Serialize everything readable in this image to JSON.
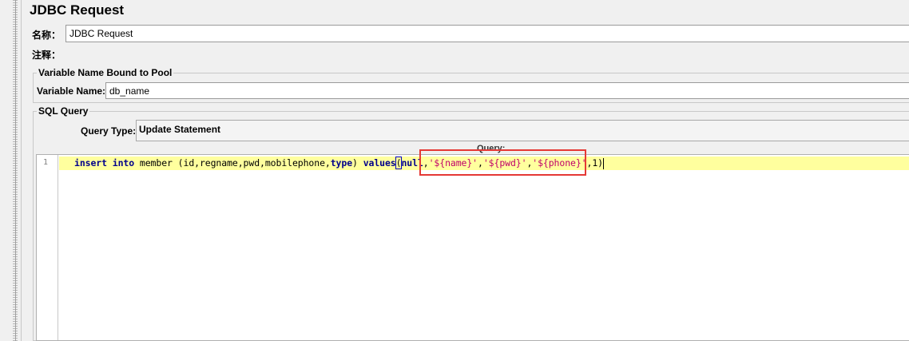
{
  "panel": {
    "title": "JDBC Request",
    "name_label": "名称：",
    "name_value": "JDBC Request",
    "comment_label": "注释："
  },
  "pool_section": {
    "legend": "Variable Name Bound to Pool",
    "variable_label": "Variable Name:",
    "variable_value": "db_name"
  },
  "sql_section": {
    "legend": "SQL Query",
    "query_type_label": "Query Type:",
    "query_type_value": "Update Statement",
    "query_label": "Query:"
  },
  "editor": {
    "line_number": "1",
    "tokens": {
      "insert": "insert",
      "into": "into",
      "rest1": " member (id,regname,pwd,mobilephone,",
      "type": "type",
      "rest2": ") ",
      "values": "values",
      "paren": "(",
      "null": "null",
      "comma0": ",",
      "s_name": "'${name}'",
      "comma1": ",",
      "s_pwd": "'${pwd}'",
      "comma2": ",",
      "s_phone": "'${phone}'",
      "tail": ",1)"
    }
  },
  "colors": {
    "keyword": "#00008b",
    "string": "#c0006a",
    "current_line": "#ffff9e",
    "annotation_box": "#e53935"
  }
}
